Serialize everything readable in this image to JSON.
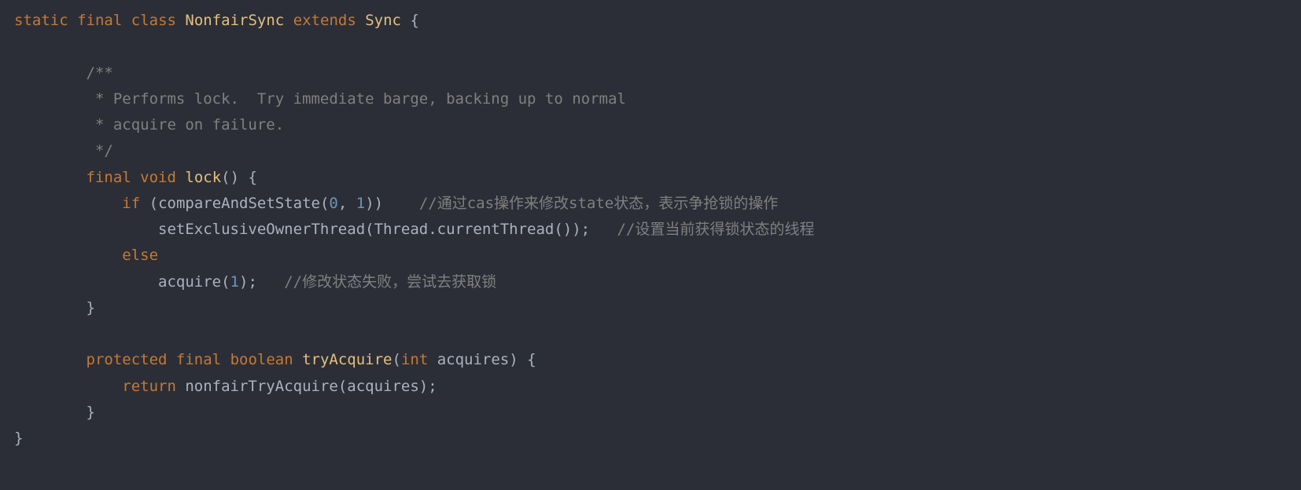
{
  "code": {
    "l1_kw1": "static",
    "l1_kw2": "final",
    "l1_kw3": "class",
    "l1_type1": "NonfairSync",
    "l1_kw4": "extends",
    "l1_type2": "Sync",
    "l1_brace": "{",
    "l3_c": "/**",
    "l4_c": " * Performs lock.  Try immediate barge, backing up to normal",
    "l5_c": " * acquire on failure.",
    "l6_c": " */",
    "l7_kw1": "final",
    "l7_kw2": "void",
    "l7_fn": "lock",
    "l7_rest": "() {",
    "l8_kw": "if",
    "l8_call1": "(compareAndSetState(",
    "l8_n0": "0",
    "l8_comma": ", ",
    "l8_n1": "1",
    "l8_close": "))",
    "l8_cmt": "//通过cas操作来修改state状态，表示争抢锁的操作",
    "l9_call": "setExclusiveOwnerThread(Thread.currentThread());",
    "l9_cmt": "//设置当前获得锁状态的线程",
    "l10_kw": "else",
    "l11_call1": "acquire(",
    "l11_n": "1",
    "l11_close": ");",
    "l11_cmt": "//修改状态失败，尝试去获取锁",
    "l12_brace": "}",
    "l14_kw1": "protected",
    "l14_kw2": "final",
    "l14_kw3": "boolean",
    "l14_fn": "tryAcquire",
    "l14_p1": "(",
    "l14_ptype": "int",
    "l14_pname": " acquires) {",
    "l15_kw": "return",
    "l15_call": " nonfairTryAcquire(acquires);",
    "l16_brace": "}",
    "l17_brace": "}"
  }
}
